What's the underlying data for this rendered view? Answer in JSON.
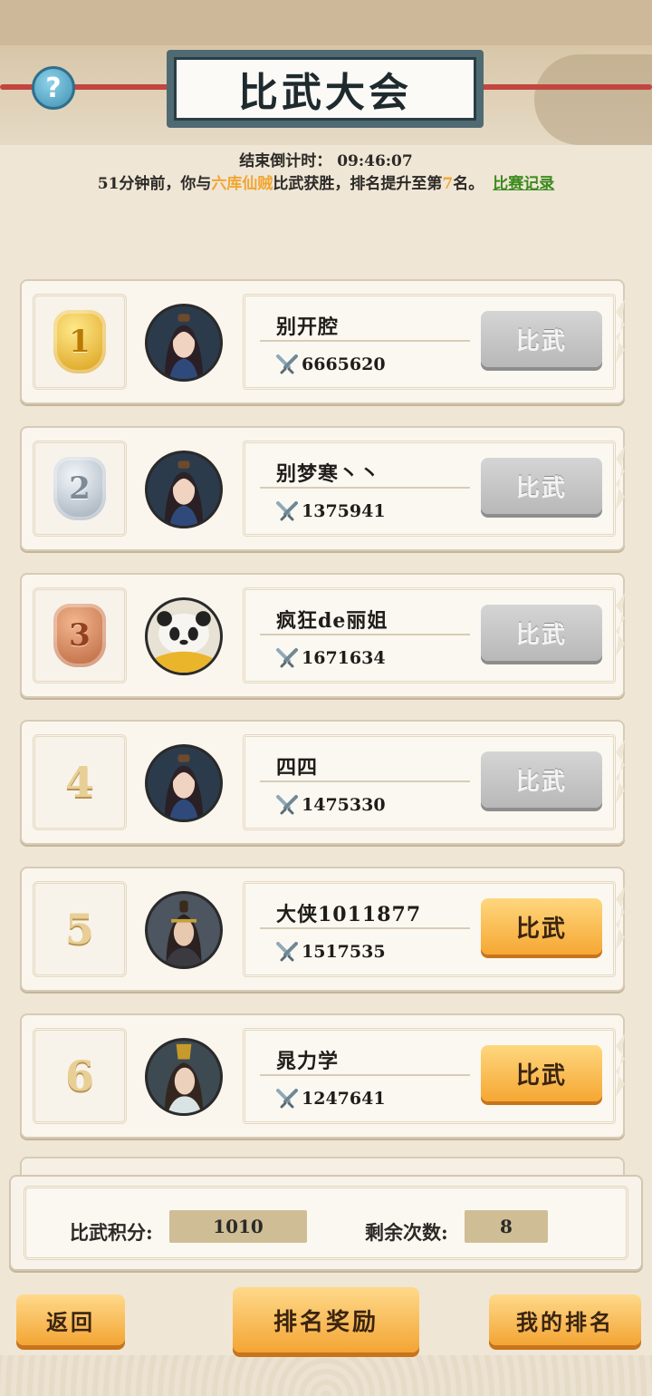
{
  "header": {
    "title": "比武大会",
    "help_icon": "question-mark",
    "countdown_label": "结束倒计时：",
    "countdown_value": "09:46:07",
    "notice": {
      "prefix": "51分钟前，你与",
      "opponent": "六库仙贼",
      "middle": "比武获胜，排名提升至第",
      "rank": "7",
      "suffix": "名。",
      "link": "比赛记录"
    }
  },
  "ranking": [
    {
      "rank": "1",
      "rank_style": "gold-medal",
      "avatar": "female-warrior",
      "name": "别开腔",
      "power": "6665620",
      "button": "比武",
      "button_state": "disabled"
    },
    {
      "rank": "2",
      "rank_style": "silver-medal",
      "avatar": "female-warrior",
      "name": "别梦寒丶丶",
      "power": "1375941",
      "button": "比武",
      "button_state": "disabled"
    },
    {
      "rank": "3",
      "rank_style": "bronze-medal",
      "avatar": "panda",
      "name": "疯狂de丽姐",
      "power": "1671634",
      "button": "比武",
      "button_state": "disabled"
    },
    {
      "rank": "4",
      "rank_style": "number",
      "avatar": "female-warrior",
      "name": "四四",
      "power": "1475330",
      "button": "比武",
      "button_state": "disabled"
    },
    {
      "rank": "5",
      "rank_style": "number",
      "avatar": "male-swordsman",
      "name": "大侠1011877",
      "power": "1517535",
      "button": "比武",
      "button_state": "active"
    },
    {
      "rank": "6",
      "rank_style": "number",
      "avatar": "male-scholar",
      "name": "晁力学",
      "power": "1247641",
      "button": "比武",
      "button_state": "active"
    }
  ],
  "stats": {
    "points_label": "比武积分:",
    "points_value": "1010",
    "remaining_label": "剩余次数:",
    "remaining_value": "8"
  },
  "footer": {
    "back": "返回",
    "rewards": "排名奖励",
    "my_rank": "我的排名"
  },
  "colors": {
    "highlight_orange": "#f1a632",
    "link_green": "#3c8a1d",
    "button_orange": "#f5a733",
    "button_grey": "#bdbdbd"
  }
}
